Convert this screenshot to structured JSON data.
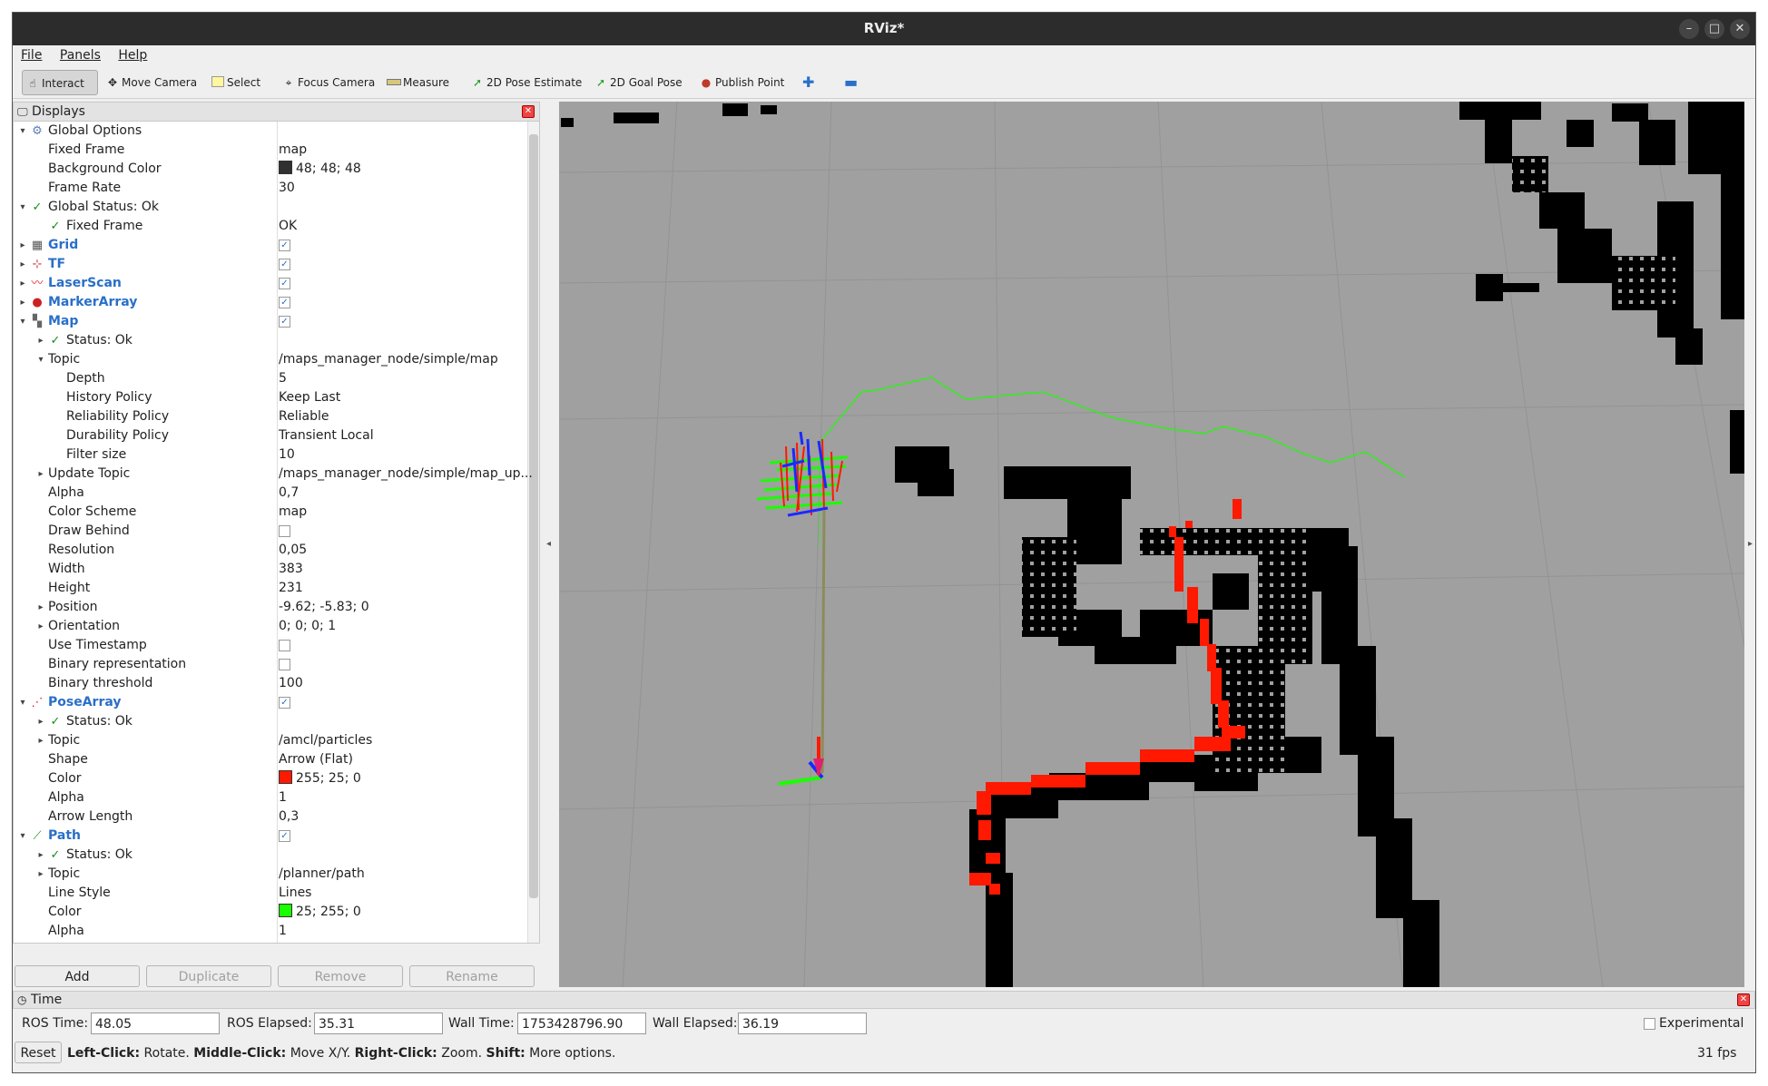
{
  "window": {
    "title": "RViz*"
  },
  "menu": [
    "File",
    "Panels",
    "Help"
  ],
  "toolbar": {
    "interact": "Interact",
    "move_camera": "Move Camera",
    "select": "Select",
    "focus_camera": "Focus Camera",
    "measure": "Measure",
    "pose_estimate": "2D Pose Estimate",
    "goal_pose": "2D Goal Pose",
    "publish_point": "Publish Point"
  },
  "displays": {
    "title": "Displays",
    "rows": [
      {
        "name": "Global Options",
        "value": "",
        "level": 0,
        "expand": "open",
        "icon": "gear-icon"
      },
      {
        "name": "Fixed Frame",
        "value": "map",
        "level": 1
      },
      {
        "name": "Background Color",
        "value": "48; 48; 48",
        "level": 1,
        "swatch": "#303030"
      },
      {
        "name": "Frame Rate",
        "value": "30",
        "level": 1
      },
      {
        "name": "Global Status: Ok",
        "value": "",
        "level": 0,
        "expand": "open",
        "icon": "check-icon"
      },
      {
        "name": "Fixed Frame",
        "value": "OK",
        "level": 1,
        "icon": "check-icon"
      },
      {
        "name": "Grid",
        "value": "",
        "level": 0,
        "expand": "closed",
        "icon": "grid-icon",
        "display": true,
        "check": true
      },
      {
        "name": "TF",
        "value": "",
        "level": 0,
        "expand": "closed",
        "icon": "tf-icon",
        "display": true,
        "check": true
      },
      {
        "name": "LaserScan",
        "value": "",
        "level": 0,
        "expand": "closed",
        "icon": "laserscan-icon",
        "display": true,
        "check": true
      },
      {
        "name": "MarkerArray",
        "value": "",
        "level": 0,
        "expand": "closed",
        "icon": "markerarray-icon",
        "display": true,
        "check": true
      },
      {
        "name": "Map",
        "value": "",
        "level": 0,
        "expand": "open",
        "icon": "map-icon",
        "display": true,
        "check": true
      },
      {
        "name": "Status: Ok",
        "value": "",
        "level": 1,
        "expand": "closed",
        "icon": "check-icon"
      },
      {
        "name": "Topic",
        "value": "/maps_manager_node/simple/map",
        "level": 1,
        "expand": "open"
      },
      {
        "name": "Depth",
        "value": "5",
        "level": 2
      },
      {
        "name": "History Policy",
        "value": "Keep Last",
        "level": 2
      },
      {
        "name": "Reliability Policy",
        "value": "Reliable",
        "level": 2
      },
      {
        "name": "Durability Policy",
        "value": "Transient Local",
        "level": 2
      },
      {
        "name": "Filter size",
        "value": "10",
        "level": 2
      },
      {
        "name": "Update Topic",
        "value": "/maps_manager_node/simple/map_up...",
        "level": 1,
        "expand": "closed"
      },
      {
        "name": "Alpha",
        "value": "0,7",
        "level": 1
      },
      {
        "name": "Color Scheme",
        "value": "map",
        "level": 1
      },
      {
        "name": "Draw Behind",
        "value": "",
        "level": 1,
        "check": false
      },
      {
        "name": "Resolution",
        "value": "0,05",
        "level": 1
      },
      {
        "name": "Width",
        "value": "383",
        "level": 1
      },
      {
        "name": "Height",
        "value": "231",
        "level": 1
      },
      {
        "name": "Position",
        "value": "-9.62; -5.83; 0",
        "level": 1,
        "expand": "closed"
      },
      {
        "name": "Orientation",
        "value": "0; 0; 0; 1",
        "level": 1,
        "expand": "closed"
      },
      {
        "name": "Use Timestamp",
        "value": "",
        "level": 1,
        "check": false
      },
      {
        "name": "Binary representation",
        "value": "",
        "level": 1,
        "check": false
      },
      {
        "name": "Binary threshold",
        "value": "100",
        "level": 1
      },
      {
        "name": "PoseArray",
        "value": "",
        "level": 0,
        "expand": "open",
        "icon": "posearray-icon",
        "display": true,
        "check": true
      },
      {
        "name": "Status: Ok",
        "value": "",
        "level": 1,
        "expand": "closed",
        "icon": "check-icon"
      },
      {
        "name": "Topic",
        "value": "/amcl/particles",
        "level": 1,
        "expand": "closed"
      },
      {
        "name": "Shape",
        "value": "Arrow (Flat)",
        "level": 1
      },
      {
        "name": "Color",
        "value": "255; 25; 0",
        "level": 1,
        "swatch": "#ff1900"
      },
      {
        "name": "Alpha",
        "value": "1",
        "level": 1
      },
      {
        "name": "Arrow Length",
        "value": "0,3",
        "level": 1
      },
      {
        "name": "Path",
        "value": "",
        "level": 0,
        "expand": "open",
        "icon": "path-icon",
        "display": true,
        "check": true
      },
      {
        "name": "Status: Ok",
        "value": "",
        "level": 1,
        "expand": "closed",
        "icon": "check-icon"
      },
      {
        "name": "Topic",
        "value": "/planner/path",
        "level": 1,
        "expand": "closed"
      },
      {
        "name": "Line Style",
        "value": "Lines",
        "level": 1
      },
      {
        "name": "Color",
        "value": "25; 255; 0",
        "level": 1,
        "swatch": "#19ff00"
      },
      {
        "name": "Alpha",
        "value": "1",
        "level": 1
      }
    ],
    "buttons": {
      "add": "Add",
      "duplicate": "Duplicate",
      "remove": "Remove",
      "rename": "Rename"
    }
  },
  "time": {
    "title": "Time",
    "ros_time_label": "ROS Time:",
    "ros_time": "48.05",
    "ros_elapsed_label": "ROS Elapsed:",
    "ros_elapsed": "35.31",
    "wall_time_label": "Wall Time:",
    "wall_time": "1753428796.90",
    "wall_elapsed_label": "Wall Elapsed:",
    "wall_elapsed": "36.19",
    "experimental": "Experimental",
    "reset": "Reset",
    "hint": [
      {
        "b": "Left-Click:",
        "t": " Rotate. "
      },
      {
        "b": "Middle-Click:",
        "t": " Move X/Y. "
      },
      {
        "b": "Right-Click:",
        "t": " Zoom. "
      },
      {
        "b": "Shift:",
        "t": " More options."
      }
    ],
    "fps": "31 fps"
  },
  "colors": {
    "particles": "#ff1900",
    "path": "#19ff00",
    "occupied": "#000000",
    "free": "#a0a0a0"
  }
}
